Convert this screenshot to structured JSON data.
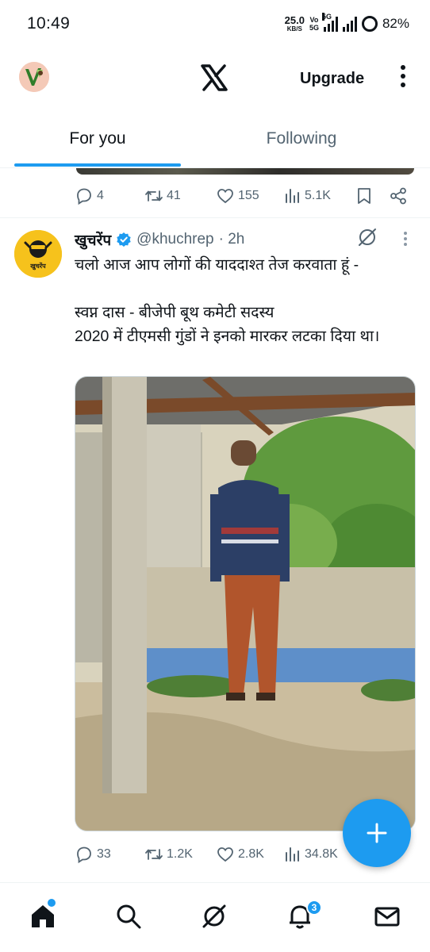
{
  "status_bar": {
    "time": "10:49",
    "net_speed_value": "25.0",
    "net_speed_unit": "KB/S",
    "volte_top": "Vo",
    "volte_bottom": "5G",
    "network_label": "5G",
    "battery": "82%"
  },
  "app_bar": {
    "logo": "X",
    "upgrade_label": "Upgrade"
  },
  "tabs": [
    {
      "label": "For you",
      "selected": true
    },
    {
      "label": "Following",
      "selected": false
    }
  ],
  "previous_tweet": {
    "replies": "4",
    "reposts": "41",
    "likes": "155",
    "views": "5.1K"
  },
  "tweet": {
    "author_name": "खुचरेंप",
    "handle": "@khuchrep",
    "time": "· 2h",
    "avatar_text": "खुचरेंप",
    "text_line1": "चलो आज आप लोगों की याददाश्त तेज करवाता हूं -",
    "text_line2": "स्वप्न दास - बीजेपी बूथ कमेटी सदस्य",
    "text_line3": "2020 में टीएमसी गुंडों ने इनको मारकर लटका दिया था।",
    "replies": "33",
    "reposts": "1.2K",
    "likes": "2.8K",
    "views": "34.8K"
  },
  "bottom_nav": {
    "notification_count": "3"
  },
  "colors": {
    "accent": "#1d9bf0",
    "text": "#0f1419",
    "muted": "#536471"
  }
}
